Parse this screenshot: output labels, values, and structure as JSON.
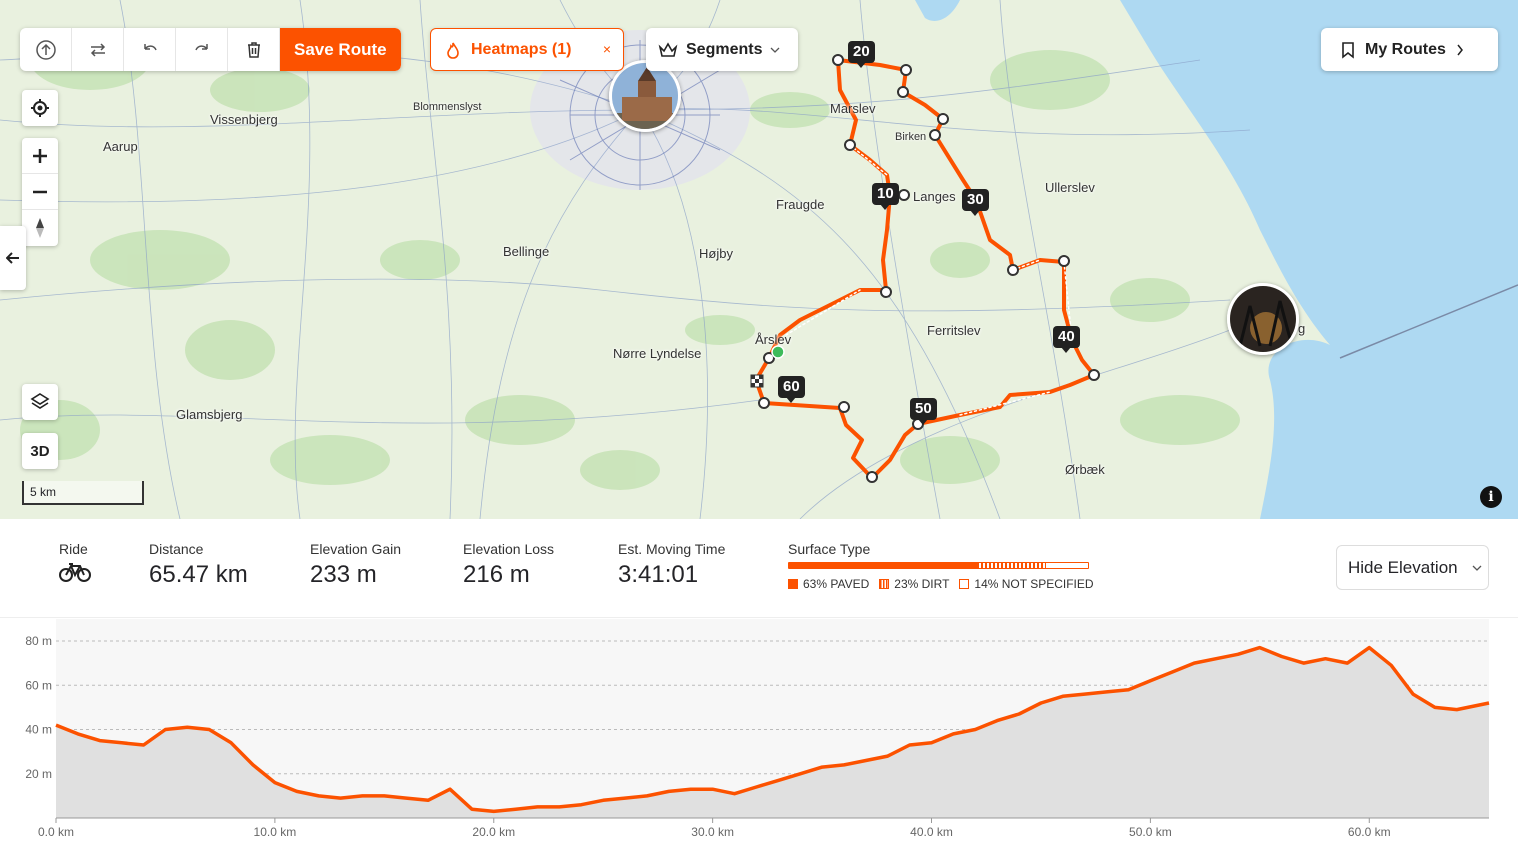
{
  "toolbar": {
    "upload_icon": "upload-icon",
    "reverse_icon": "swap-arrows-icon",
    "undo_icon": "undo-icon",
    "redo_icon": "redo-icon",
    "delete_icon": "trash-icon",
    "save_label": "Save Route"
  },
  "heatmaps": {
    "label": "Heatmaps (1)",
    "close": "×"
  },
  "segments": {
    "label": "Segments"
  },
  "my_routes": {
    "label": "My Routes"
  },
  "map_controls": {
    "three_d": "3D",
    "scale": "5 km",
    "info": "i"
  },
  "places": [
    {
      "name": "Blommenslyst",
      "small": true
    },
    {
      "name": "Vissenbjerg",
      "small": false
    },
    {
      "name": "Aarup",
      "small": false
    },
    {
      "name": "Marslev",
      "small": false
    },
    {
      "name": "Birken",
      "small": true
    },
    {
      "name": "Langes",
      "small": false
    },
    {
      "name": "Ullerslev",
      "small": false
    },
    {
      "name": "Fraugde",
      "small": false
    },
    {
      "name": "Bellinge",
      "small": false
    },
    {
      "name": "Højby",
      "small": false
    },
    {
      "name": "Årslev",
      "small": false
    },
    {
      "name": "Nørre Lyndelse",
      "small": false
    },
    {
      "name": "Ferritslev",
      "small": false
    },
    {
      "name": "Glamsbjerg",
      "small": false
    },
    {
      "name": "Ørbæk",
      "small": false
    },
    {
      "name": "g",
      "small": false
    }
  ],
  "km_markers": [
    "10",
    "20",
    "30",
    "40",
    "50",
    "60"
  ],
  "stats": {
    "activity_label": "Ride",
    "activity_icon": "bike-icon",
    "distance": {
      "label": "Distance",
      "value": "65.47 km"
    },
    "elevation_gain": {
      "label": "Elevation Gain",
      "value": "233 m"
    },
    "elevation_loss": {
      "label": "Elevation Loss",
      "value": "216 m"
    },
    "moving_time": {
      "label": "Est. Moving Time",
      "value": "3:41:01"
    },
    "surface": {
      "label": "Surface Type",
      "items": [
        {
          "label": "63% PAVED",
          "fraction": 0.63,
          "style": "solid"
        },
        {
          "label": "23% DIRT",
          "fraction": 0.23,
          "style": "striped"
        },
        {
          "label": "14% NOT SPECIFIED",
          "fraction": 0.14,
          "style": "empty"
        }
      ]
    },
    "hide_elevation": "Hide Elevation"
  },
  "chart_data": {
    "type": "area",
    "xlabel": "",
    "ylabel": "",
    "x_ticks": [
      "0.0 km",
      "10.0 km",
      "20.0 km",
      "30.0 km",
      "40.0 km",
      "50.0 km",
      "60.0 km"
    ],
    "y_ticks": [
      "20 m",
      "40 m",
      "60 m",
      "80 m"
    ],
    "xlim": [
      0,
      65.47
    ],
    "ylim": [
      0,
      80
    ],
    "grid": true,
    "color": "#fc5200",
    "x": [
      0,
      1,
      2,
      3,
      4,
      5,
      6,
      7,
      8,
      9,
      10,
      11,
      12,
      13,
      14,
      15,
      16,
      17,
      18,
      19,
      20,
      21,
      22,
      23,
      24,
      25,
      26,
      27,
      28,
      29,
      30,
      31,
      32,
      33,
      34,
      35,
      36,
      37,
      38,
      39,
      40,
      41,
      42,
      43,
      44,
      45,
      46,
      47,
      48,
      49,
      50,
      51,
      52,
      53,
      54,
      55,
      56,
      57,
      58,
      59,
      60,
      61,
      62,
      63,
      64,
      65.47
    ],
    "y": [
      42,
      38,
      35,
      34,
      33,
      40,
      41,
      40,
      34,
      24,
      16,
      12,
      10,
      9,
      10,
      10,
      9,
      8,
      13,
      4,
      3,
      4,
      5,
      5,
      6,
      8,
      9,
      10,
      12,
      13,
      13,
      11,
      14,
      17,
      20,
      23,
      24,
      26,
      28,
      33,
      34,
      38,
      40,
      44,
      47,
      52,
      55,
      56,
      57,
      58,
      62,
      66,
      70,
      72,
      74,
      77,
      73,
      70,
      72,
      70,
      77,
      69,
      56,
      50,
      49,
      52
    ]
  }
}
